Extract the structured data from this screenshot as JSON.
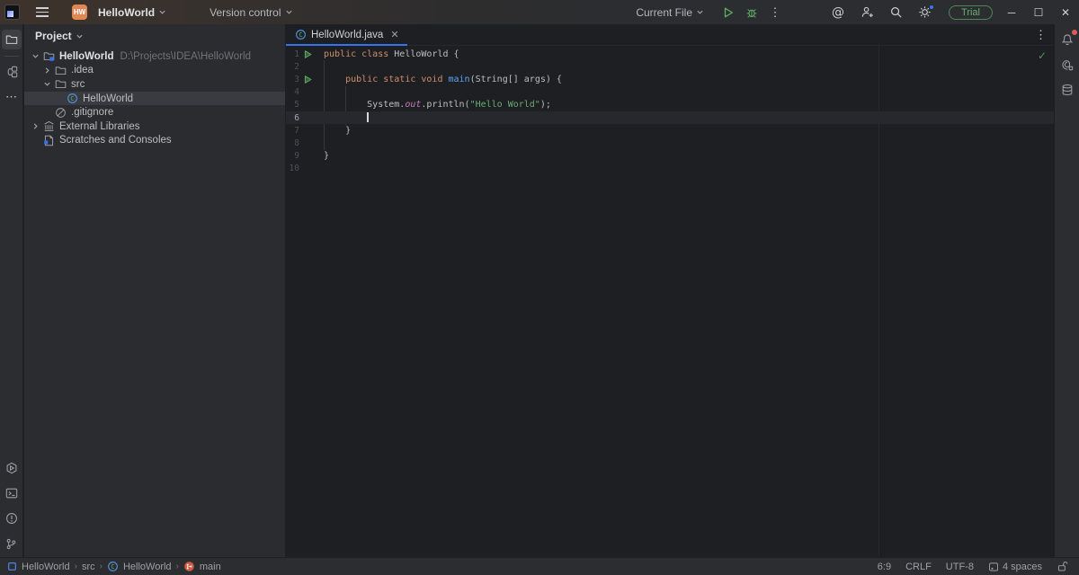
{
  "titlebar": {
    "project_name": "HelloWorld",
    "project_badge": "HW",
    "vcs_label": "Version control",
    "run_config_label": "Current File",
    "trial_label": "Trial",
    "icons": [
      "menu-icon",
      "chevron-down-icon",
      "run-icon",
      "debug-icon",
      "more-icon",
      "ai-icon",
      "add-user-icon",
      "search-icon",
      "settings-icon",
      "minimize-icon",
      "maximize-icon",
      "close-icon"
    ]
  },
  "left_strip": {
    "icons": [
      "project-folder-icon",
      "structure-icon",
      "more-tools-icon",
      "services-icon",
      "terminal-icon",
      "problems-icon",
      "git-branch-icon"
    ]
  },
  "right_strip": {
    "icons": [
      "notifications-bell-icon",
      "ai-assistant-icon",
      "database-icon"
    ]
  },
  "project_panel": {
    "header": "Project",
    "tree": [
      {
        "level": 0,
        "chevron": "down",
        "icon": "project-folder",
        "label": "HelloWorld",
        "extra": "D:\\Projects\\IDEA\\HelloWorld",
        "bold": true,
        "selected": false
      },
      {
        "level": 1,
        "chevron": "right",
        "icon": "folder",
        "label": ".idea",
        "extra": "",
        "bold": false,
        "selected": false
      },
      {
        "level": 1,
        "chevron": "down",
        "icon": "folder",
        "label": "src",
        "extra": "",
        "bold": false,
        "selected": false
      },
      {
        "level": 2,
        "chevron": null,
        "icon": "class",
        "label": "HelloWorld",
        "extra": "",
        "bold": false,
        "selected": true
      },
      {
        "level": 1,
        "chevron": null,
        "icon": "ignored",
        "label": ".gitignore",
        "extra": "",
        "bold": false,
        "selected": false
      },
      {
        "level": 0,
        "chevron": "right",
        "icon": "library",
        "label": "External Libraries",
        "extra": "",
        "bold": false,
        "selected": false
      },
      {
        "level": 0,
        "chevron": null,
        "icon": "scratches",
        "label": "Scratches and Consoles",
        "extra": "",
        "bold": false,
        "selected": false
      }
    ]
  },
  "editor": {
    "tab": {
      "label": "HelloWorld.java",
      "icon": "class",
      "close": "✕"
    },
    "inspections_ok": "✓",
    "lines": [
      {
        "n": 1,
        "run": true,
        "current": false,
        "caret": false,
        "tokens": [
          [
            "kw",
            "public class "
          ],
          [
            "pl",
            "HelloWorld {"
          ]
        ]
      },
      {
        "n": 2,
        "run": false,
        "current": false,
        "caret": false,
        "tokens": []
      },
      {
        "n": 3,
        "run": true,
        "current": false,
        "caret": false,
        "tokens": [
          [
            "pl",
            "    "
          ],
          [
            "kw",
            "public static void "
          ],
          [
            "fn",
            "main"
          ],
          [
            "pl",
            "(String[] args) {"
          ]
        ]
      },
      {
        "n": 4,
        "run": false,
        "current": false,
        "caret": false,
        "tokens": []
      },
      {
        "n": 5,
        "run": false,
        "current": false,
        "caret": false,
        "tokens": [
          [
            "pl",
            "        System."
          ],
          [
            "fd",
            "out"
          ],
          [
            "pl",
            ".println("
          ],
          [
            "str",
            "\"Hello World\""
          ],
          [
            "pl",
            ");"
          ]
        ]
      },
      {
        "n": 6,
        "run": false,
        "current": true,
        "caret": true,
        "tokens": [
          [
            "pl",
            "        "
          ]
        ]
      },
      {
        "n": 7,
        "run": false,
        "current": false,
        "caret": false,
        "tokens": [
          [
            "pl",
            "    }"
          ]
        ]
      },
      {
        "n": 8,
        "run": false,
        "current": false,
        "caret": false,
        "tokens": []
      },
      {
        "n": 9,
        "run": false,
        "current": false,
        "caret": false,
        "tokens": [
          [
            "pl",
            "}"
          ]
        ]
      },
      {
        "n": 10,
        "run": false,
        "current": false,
        "caret": false,
        "tokens": []
      }
    ]
  },
  "statusbar": {
    "breadcrumbs": [
      {
        "icon": "module",
        "label": "HelloWorld"
      },
      {
        "icon": null,
        "label": "src"
      },
      {
        "icon": "class",
        "label": "HelloWorld"
      },
      {
        "icon": "git",
        "label": "main"
      }
    ],
    "caret_position": "6:9",
    "line_ending": "CRLF",
    "encoding": "UTF-8",
    "indent": "4 spaces"
  },
  "colors": {
    "accent": "#3574f0",
    "editor_bg": "#1e1f22",
    "panel_bg": "#2b2d30",
    "keyword": "#cf8e6d",
    "string": "#6aab73",
    "field": "#c77dbb",
    "method": "#56a8f5",
    "run_green": "#5fad65",
    "trial_green": "#6aab73",
    "project_badge_orange": "#e08855",
    "notification_red": "#db5c5c"
  }
}
